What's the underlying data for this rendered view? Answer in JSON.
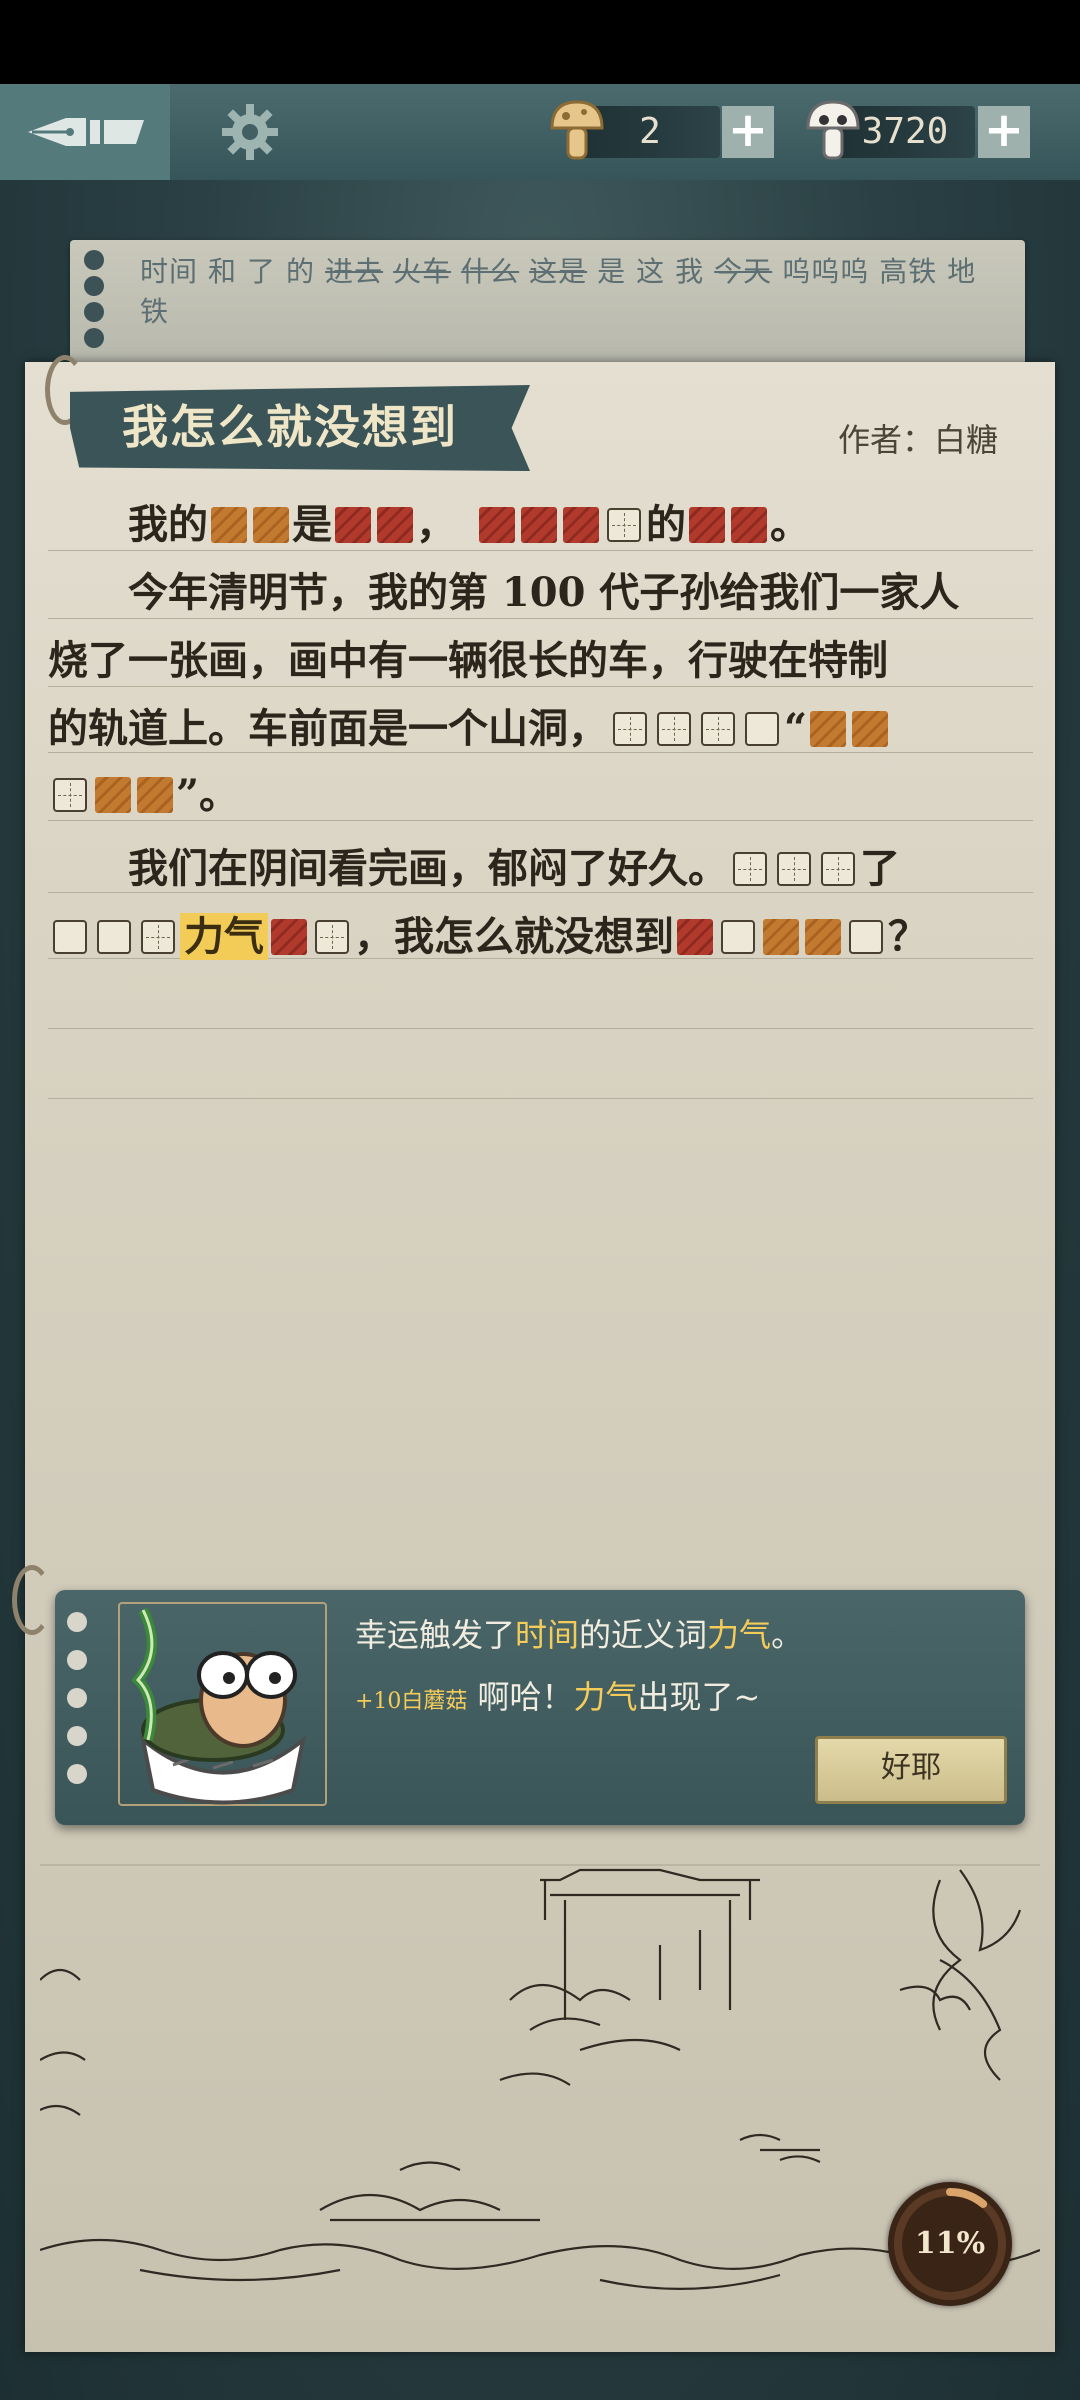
{
  "hud": {
    "mushroom_count": "2",
    "skull_count": "3720",
    "plus_label": "+"
  },
  "word_bank": [
    {
      "text": "时间",
      "struck": false
    },
    {
      "text": "和",
      "struck": false
    },
    {
      "text": "了",
      "struck": false
    },
    {
      "text": "的",
      "struck": false
    },
    {
      "text": "进去",
      "struck": true
    },
    {
      "text": "火车",
      "struck": true
    },
    {
      "text": "什么",
      "struck": true
    },
    {
      "text": "这是",
      "struck": true
    },
    {
      "text": "是",
      "struck": false
    },
    {
      "text": "这",
      "struck": false
    },
    {
      "text": "我",
      "struck": false
    },
    {
      "text": "今天",
      "struck": true
    },
    {
      "text": "呜呜呜",
      "struck": false
    },
    {
      "text": "高铁",
      "struck": false
    },
    {
      "text": "地铁",
      "struck": false
    }
  ],
  "story": {
    "title": "我怎么就没想到",
    "author": "作者：白糖",
    "lines": [
      [
        [
          "t",
          "　　我的"
        ],
        [
          "o"
        ],
        [
          "o"
        ],
        [
          "t",
          "是"
        ],
        [
          "r"
        ],
        [
          "r"
        ],
        [
          "t",
          "，　"
        ],
        [
          "r"
        ],
        [
          "r"
        ],
        [
          "r"
        ],
        [
          "g"
        ],
        [
          "t",
          "的"
        ],
        [
          "r"
        ],
        [
          "r"
        ],
        [
          "t",
          "。"
        ]
      ],
      [
        [
          "t",
          "　　今年清明节，我的第 100 代子孙给我们一家人"
        ]
      ],
      [
        [
          "t",
          "烧了一张画，画中有一辆很长的车，行驶在特制"
        ]
      ],
      [
        [
          "t",
          "的轨道上。车前面是一个山洞，"
        ],
        [
          "g"
        ],
        [
          "g"
        ],
        [
          "g"
        ],
        [
          "b"
        ],
        [
          "t",
          "“"
        ],
        [
          "o"
        ],
        [
          "o"
        ]
      ],
      [
        [
          "g"
        ],
        [
          "o"
        ],
        [
          "o"
        ],
        [
          "t",
          "”。"
        ]
      ],
      [
        [
          "t",
          "　　我们在阴间看完画，郁闷了好久。"
        ],
        [
          "g"
        ],
        [
          "g"
        ],
        [
          "g"
        ],
        [
          "t",
          "了"
        ]
      ],
      [
        [
          "b"
        ],
        [
          "b"
        ],
        [
          "g"
        ],
        [
          "h",
          "力气"
        ],
        [
          "r"
        ],
        [
          "g"
        ],
        [
          "t",
          "，我怎么就没想到"
        ],
        [
          "r"
        ],
        [
          "b"
        ],
        [
          "o"
        ],
        [
          "o"
        ],
        [
          "b"
        ],
        [
          "t",
          "？"
        ]
      ]
    ]
  },
  "popup": {
    "line1_a": "幸运触发了",
    "line1_b": "时间",
    "line1_c": "的近义词",
    "line1_d": "力气",
    "line1_e": "。",
    "reward": "+10白蘑菇",
    "line2_a": "啊哈！",
    "line2_b": "力气",
    "line2_c": "出现了~",
    "button": "好耶"
  },
  "progress": {
    "label": "11%",
    "value": 0.11
  }
}
